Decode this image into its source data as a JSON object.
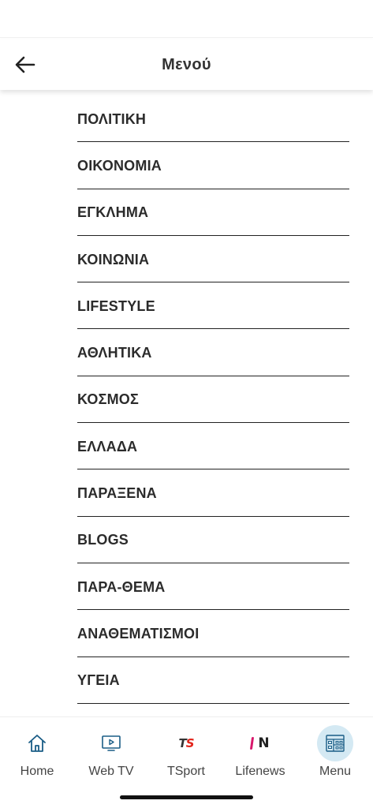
{
  "header": {
    "title": "Μενού"
  },
  "menu": {
    "items": [
      {
        "label": "ΠΟΛΙΤΙΚΗ"
      },
      {
        "label": "ΟΙΚΟΝΟΜΙΑ"
      },
      {
        "label": "ΕΓΚΛΗΜΑ"
      },
      {
        "label": "ΚΟΙΝΩΝΙΑ"
      },
      {
        "label": "LIFESTYLE"
      },
      {
        "label": "ΑΘΛΗΤΙΚΑ"
      },
      {
        "label": "ΚΟΣΜΟΣ"
      },
      {
        "label": "ΕΛΛΑΔΑ"
      },
      {
        "label": "ΠΑΡΑΞΕΝΑ"
      },
      {
        "label": "BLOGS"
      },
      {
        "label": "ΠΑΡΑ-ΘΕΜΑ"
      },
      {
        "label": "ΑΝΑΘΕΜΑΤΙΣΜΟΙ"
      },
      {
        "label": "ΥΓΕΙΑ"
      }
    ]
  },
  "tabs": {
    "home": {
      "label": "Home",
      "icon": "home-icon"
    },
    "webtv": {
      "label": "Web TV",
      "icon": "tv-play-icon"
    },
    "tsport": {
      "label": "TSport",
      "logo_text": "TS",
      "icon": "tsport-logo"
    },
    "lifenews": {
      "label": "Lifenews",
      "logo_text": "N",
      "icon": "lifenews-logo"
    },
    "menu": {
      "label": "Menu",
      "icon": "menu-grid-icon",
      "active": true
    }
  },
  "colors": {
    "accent_active_bg": "#d4e9f3",
    "icon_blue": "#1a5d86",
    "tsport_red": "#e2231a",
    "lifenews_pink": "#d8176b",
    "text_dark": "#2b2b2b"
  }
}
